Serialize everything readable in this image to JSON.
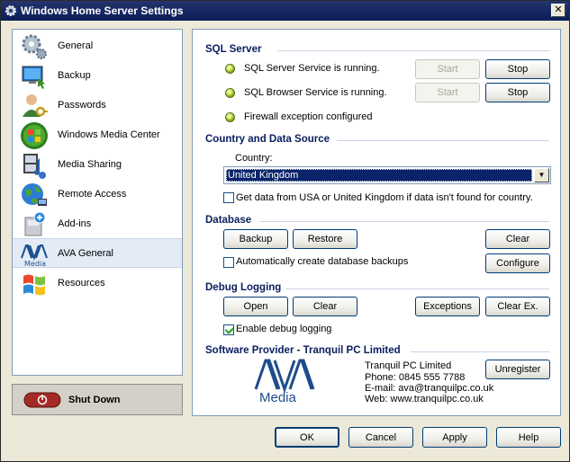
{
  "window": {
    "title": "Windows Home Server Settings",
    "close_label": "✕"
  },
  "nav": {
    "items": [
      {
        "label": "General",
        "icon": "gears-icon"
      },
      {
        "label": "Backup",
        "icon": "backup-icon"
      },
      {
        "label": "Passwords",
        "icon": "user-key-icon"
      },
      {
        "label": "Windows Media Center",
        "icon": "windows-media-center-icon"
      },
      {
        "label": "Media Sharing",
        "icon": "media-sharing-icon"
      },
      {
        "label": "Remote Access",
        "icon": "globe-icon"
      },
      {
        "label": "Add-ins",
        "icon": "add-ins-icon"
      },
      {
        "label": "AVA General",
        "icon": "ava-media-icon",
        "selected": true
      },
      {
        "label": "Resources",
        "icon": "windows-flag-icon"
      }
    ],
    "shutdown_label": "Shut Down"
  },
  "sql_server": {
    "title": "SQL Server",
    "service_status": "SQL Server Service is running.",
    "browser_status": "SQL Browser Service is running.",
    "firewall_status": "Firewall exception configured",
    "start_label": "Start",
    "stop_label": "Stop"
  },
  "country": {
    "title": "Country and Data Source",
    "label": "Country:",
    "selected": "United Kingdom",
    "fallback_label": "Get data from USA or United Kingdom if data isn't found for country.",
    "fallback_checked": false
  },
  "database": {
    "title": "Database",
    "backup_label": "Backup",
    "restore_label": "Restore",
    "clear_label": "Clear",
    "auto_backup_label": "Automatically create database backups",
    "auto_backup_checked": false,
    "configure_label": "Configure"
  },
  "debug": {
    "title": "Debug Logging",
    "open_label": "Open",
    "clear_label": "Clear",
    "exceptions_label": "Exceptions",
    "clear_ex_label": "Clear Ex.",
    "enable_label": "Enable debug logging",
    "enable_checked": true
  },
  "provider": {
    "title": "Software Provider - Tranquil PC Limited",
    "logo_text": "Media",
    "company": "Tranquil PC Limited",
    "phone": "Phone: 0845 555 7788",
    "email": "E-mail: ava@tranquilpc.co.uk",
    "web": "Web: www.tranquilpc.co.uk",
    "unregister_label": "Unregister"
  },
  "footer": {
    "ok_label": "OK",
    "cancel_label": "Cancel",
    "apply_label": "Apply",
    "help_label": "Help"
  },
  "colors": {
    "title_bar": "#0b1d58",
    "section_heading": "#0b2060",
    "status_led": "#8bb71a"
  }
}
